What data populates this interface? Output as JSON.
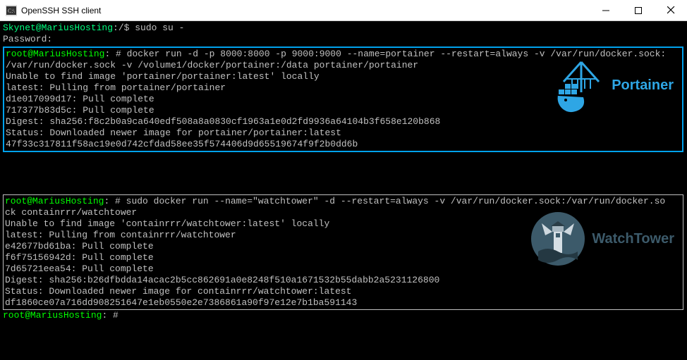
{
  "titlebar": {
    "icon_label": "cmd",
    "title": "OpenSSH SSH client"
  },
  "terminal": {
    "line_user": "Skynet@MariusHosting",
    "line_user_suffix": ":/$ ",
    "cmd_sudo": "sudo su -",
    "line_password": "Password:",
    "block1": {
      "prompt": "root@MariusHosting",
      "prompt_suffix": ": # ",
      "cmd": "docker run -d -p 8000:8000 -p 9000:9000 --name=portainer --restart=always -v /var/run/docker.sock:",
      "cmd2": "/var/run/docker.sock -v /volume1/docker/portainer:/data portainer/portainer",
      "out1": "Unable to find image 'portainer/portainer:latest' locally",
      "out2": "latest: Pulling from portainer/portainer",
      "out3": "d1e017099d17: Pull complete",
      "out4": "717377b83d5c: Pull complete",
      "out5": "Digest: sha256:f8c2b0a9ca640edf508a8a0830cf1963a1e0d2fd9936a64104b3f658e120b868",
      "out6": "Status: Downloaded newer image for portainer/portainer:latest",
      "out7": "47f33c317811f58ac19e0d742cfdad58ee35f574406d9d65519674f9f2b0dd6b",
      "logo_text": "Portainer"
    },
    "block2": {
      "prompt": "root@MariusHosting",
      "prompt_suffix": ": # ",
      "cmd": "sudo docker run --name=\"watchtower\" -d --restart=always -v /var/run/docker.sock:/var/run/docker.so",
      "cmd2": "ck containrrr/watchtower",
      "out1": "Unable to find image 'containrrr/watchtower:latest' locally",
      "out2": "latest: Pulling from containrrr/watchtower",
      "out3": "e42677bd61ba: Pull complete",
      "out4": "f6f75156942d: Pull complete",
      "out5": "7d65721eea54: Pull complete",
      "out6": "Digest: sha256:b26dfbdda14acac2b5cc862691a0e8248f510a1671532b55dabb2a5231126800",
      "out7": "Status: Downloaded newer image for containrrr/watchtower:latest",
      "out8": "df1860ce07a716dd908251647e1eb0550e2e7386861a90f97e12e7b1ba591143",
      "logo_text": "WatchTower"
    },
    "after_prompt": "root@MariusHosting",
    "after_suffix": ": #"
  }
}
